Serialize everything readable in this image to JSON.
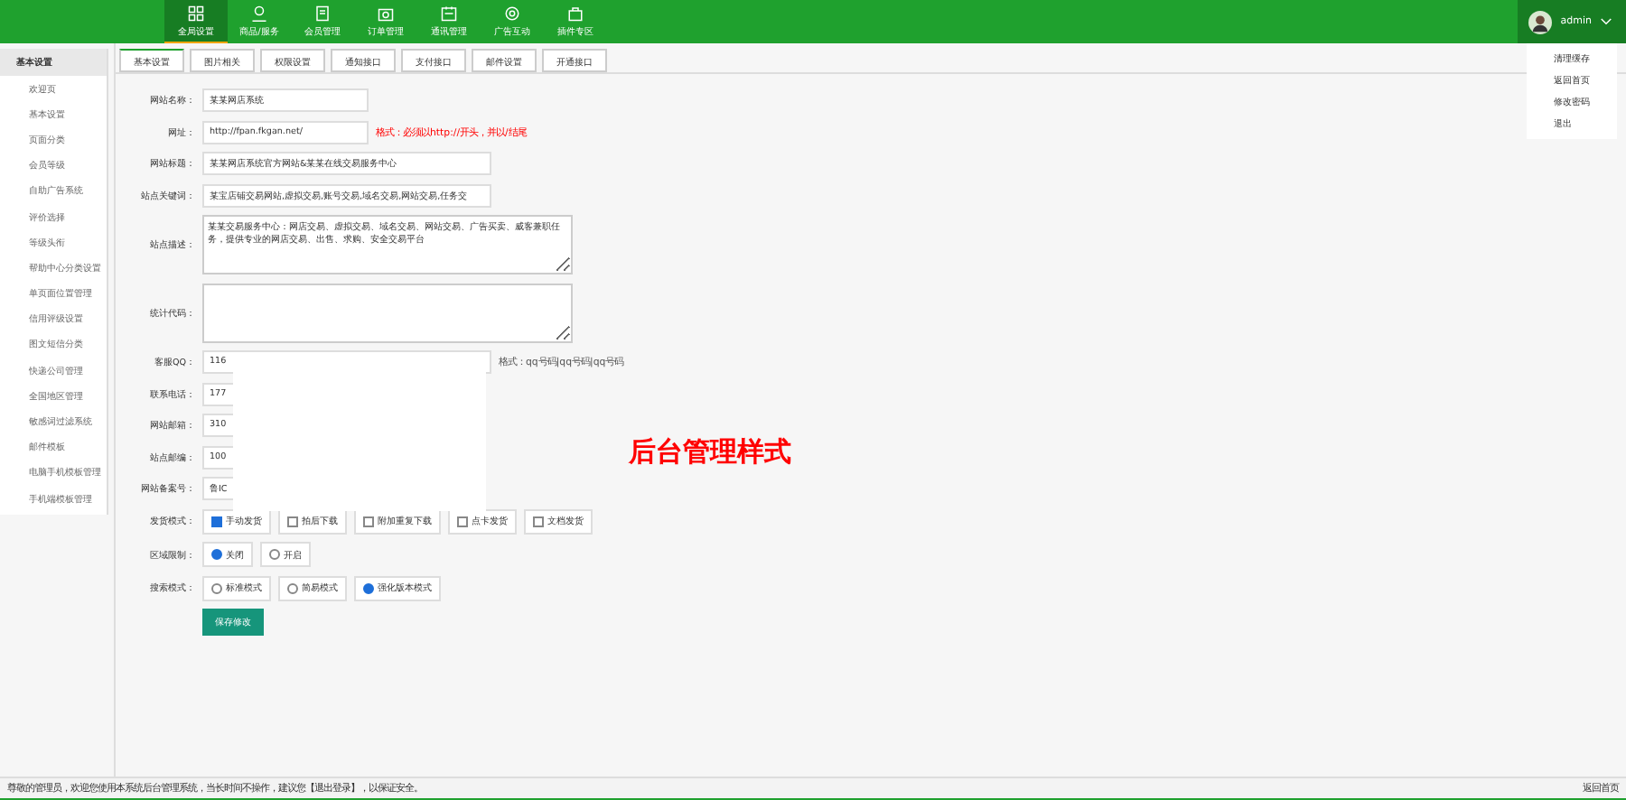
{
  "top_nav": [
    {
      "label": "全局设置",
      "selected": true
    },
    {
      "label": "商品/服务",
      "selected": false
    },
    {
      "label": "会员管理",
      "selected": false
    },
    {
      "label": "订单管理",
      "selected": false
    },
    {
      "label": "通讯管理",
      "selected": false
    },
    {
      "label": "广告互动",
      "selected": false
    },
    {
      "label": "插件专区",
      "selected": false
    }
  ],
  "user": {
    "name": "admin",
    "menu": [
      "清理缓存",
      "返回首页",
      "修改密码",
      "退出"
    ]
  },
  "sidebar": {
    "title": "基本设置",
    "items": [
      "欢迎页",
      "基本设置",
      "页面分类",
      "会员等级",
      "自助广告系统",
      "评价选择",
      "等级头衔",
      "帮助中心分类设置",
      "单页面位置管理",
      "信用评级设置",
      "图文短信分类",
      "快递公司管理",
      "全国地区管理",
      "敏感词过滤系统",
      "邮件模板",
      "电脑手机模板管理",
      "手机端模板管理"
    ]
  },
  "tabs": [
    {
      "label": "基本设置",
      "selected": true
    },
    {
      "label": "图片相关",
      "selected": false
    },
    {
      "label": "权限设置",
      "selected": false
    },
    {
      "label": "通知接口",
      "selected": false
    },
    {
      "label": "支付接口",
      "selected": false
    },
    {
      "label": "邮件设置",
      "selected": false
    },
    {
      "label": "开通接口",
      "selected": false
    }
  ],
  "form": [
    {
      "kind": "input",
      "label": "网站名称：",
      "value": "某某网店系统"
    },
    {
      "kind": "input",
      "label": "网址：",
      "value": "http://fpan.fkgan.net/",
      "note": "格式：必须以http://开头，并以/结尾",
      "note_error": true
    },
    {
      "kind": "wide_input",
      "label": "网站标题：",
      "value": "某某网店系统官方网站&某某在线交易服务中心"
    },
    {
      "kind": "wide_input",
      "label": "站点关键词：",
      "value": "某宝店铺交易网站,虚拟交易,账号交易,域名交易,网站交易,任务交"
    },
    {
      "kind": "textarea",
      "label": "站点描述：",
      "value": "某某交易服务中心：网店交易、虚拟交易、域名交易、网站交易、广告买卖、威客兼职任务，提供专业的网店交易、出售、求购、安全交易平台"
    },
    {
      "kind": "textarea",
      "label": "统计代码："
    },
    {
      "kind": "wide_input",
      "label": "客服QQ：",
      "value": "116",
      "note": "格式：qq号码|qq号码|qq号码",
      "note_error": false
    },
    {
      "kind": "input",
      "label": "联系电话：",
      "value": "177"
    },
    {
      "kind": "input",
      "label": "网站邮箱：",
      "value": "310"
    },
    {
      "kind": "input",
      "label": "站点邮编：",
      "value": "100"
    },
    {
      "kind": "input",
      "label": "网站备案号：",
      "value": "鲁IC"
    },
    {
      "kind": "checks",
      "label": "发货模式：",
      "options": [
        {
          "label": "手动发货",
          "checked": true
        },
        {
          "label": "拍后下载",
          "checked": false
        },
        {
          "label": "附加重复下载",
          "checked": false
        },
        {
          "label": "点卡发货",
          "checked": false
        },
        {
          "label": "文档发货",
          "checked": false
        }
      ]
    },
    {
      "kind": "radios",
      "label": "区域限制：",
      "options": [
        {
          "label": "关闭",
          "selected": true
        },
        {
          "label": "开启",
          "selected": false
        }
      ]
    },
    {
      "kind": "radios",
      "label": "搜索模式：",
      "options": [
        {
          "label": "标准模式",
          "selected": false
        },
        {
          "label": "简易模式",
          "selected": false
        },
        {
          "label": "强化版本模式",
          "selected": true
        }
      ]
    }
  ],
  "save_button": "保存修改",
  "banner_text": "后台管理样式",
  "footer": {
    "message": "尊敬的管理员，欢迎您使用本系统后台管理系统，当长时间不操作，建议您【退出登录】，以保证安全。",
    "link": "返回首页"
  }
}
